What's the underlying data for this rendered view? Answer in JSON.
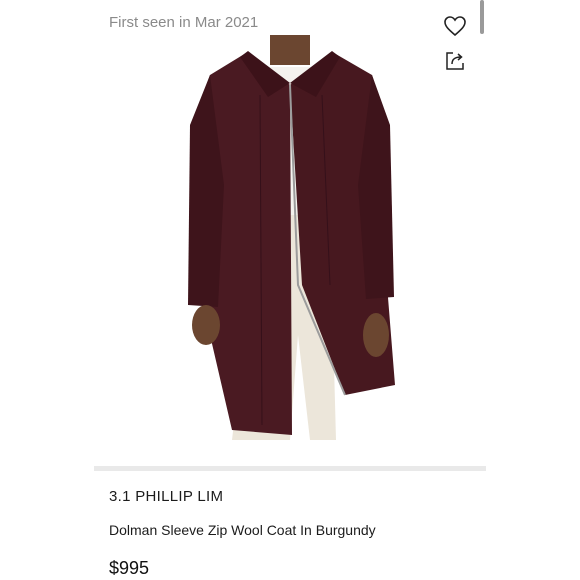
{
  "listing": {
    "first_seen": "First seen in Mar 2021"
  },
  "actions": {
    "favorite_icon": "heart-icon",
    "share_icon": "share-icon"
  },
  "product": {
    "brand": "3.1 PHILLIP LIM",
    "name": "Dolman Sleeve Zip Wool Coat In Burgundy",
    "price": "$995",
    "coat_color": "#4a1a22",
    "pants_color": "#ece6da"
  }
}
